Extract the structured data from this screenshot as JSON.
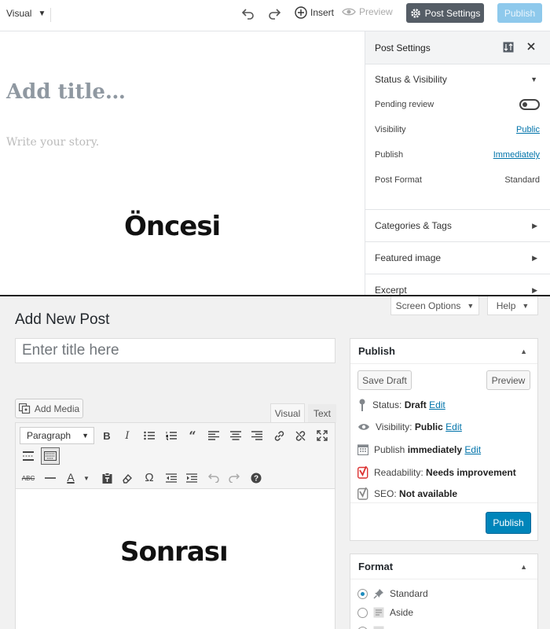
{
  "top": {
    "mode_label": "Visual",
    "insert_label": "Insert",
    "preview_label": "Preview",
    "post_settings_label": "Post Settings",
    "publish_label": "Publish",
    "title_placeholder": "Add title…",
    "story_placeholder": "Write your story.",
    "caption": "Öncesi",
    "sidebar": {
      "title": "Post Settings",
      "status_section": "Status & Visibility",
      "pending_review": "Pending review",
      "pending_review_on": false,
      "visibility_label": "Visibility",
      "visibility_value": "Public",
      "publish_label": "Publish",
      "publish_value": "Immediately",
      "format_label": "Post Format",
      "format_value": "Standard",
      "categories_section": "Categories & Tags",
      "featured_section": "Featured image",
      "excerpt_section": "Excerpt"
    }
  },
  "bottom": {
    "screen_options": "Screen Options",
    "help": "Help",
    "page_title": "Add New Post",
    "title_placeholder": "Enter title here",
    "add_media": "Add Media",
    "tab_visual": "Visual",
    "tab_text": "Text",
    "format_select": "Paragraph",
    "caption": "Sonrası",
    "publish_box": {
      "title": "Publish",
      "save_draft": "Save Draft",
      "preview": "Preview",
      "status_label": "Status:",
      "status_value": "Draft",
      "visibility_label": "Visibility:",
      "visibility_value": "Public",
      "publish_label": "Publish",
      "publish_value": "immediately",
      "edit": "Edit",
      "readability_label": "Readability:",
      "readability_value": "Needs improvement",
      "seo_label": "SEO:",
      "seo_value": "Not available",
      "publish_button": "Publish"
    },
    "format_box": {
      "title": "Format",
      "options": [
        "Standard",
        "Aside"
      ],
      "selected": "Standard"
    }
  },
  "colors": {
    "accent": "#0085ba",
    "link": "#0073aa",
    "readability_bad": "#dc3232"
  }
}
